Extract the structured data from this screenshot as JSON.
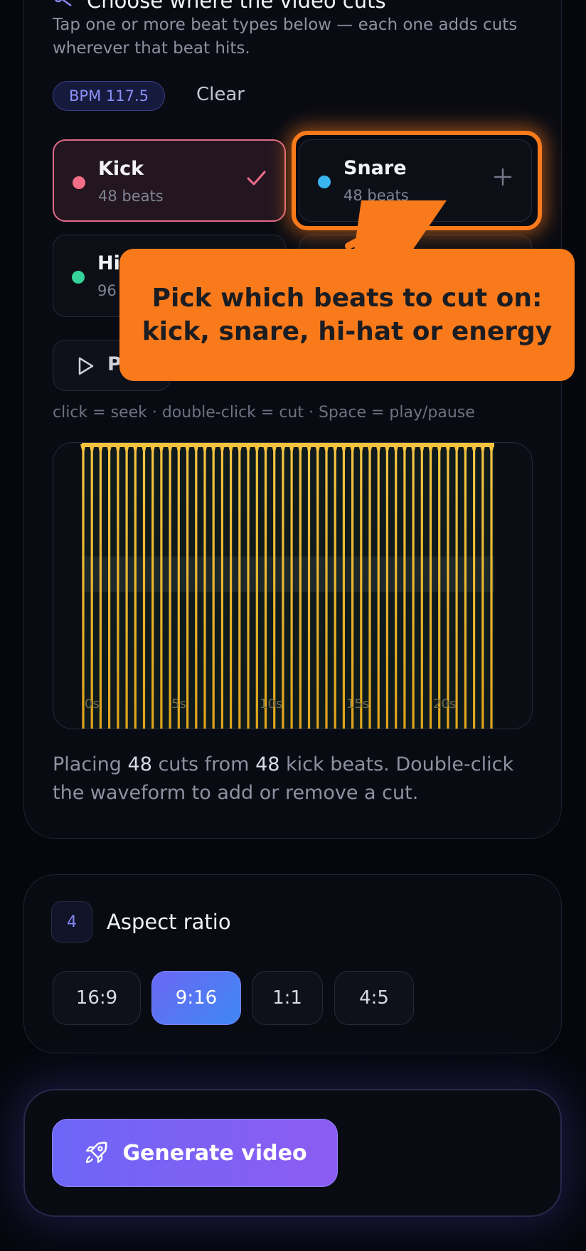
{
  "cuts": {
    "title": "Choose where the video cuts",
    "description": "Tap one or more beat types below — each one adds cuts wherever that beat hits.",
    "bpm": "BPM 117.5",
    "clear": "Clear",
    "beats": [
      {
        "name": "Kick",
        "count": "48 beats",
        "color": "#f26d85",
        "selected": true
      },
      {
        "name": "Snare",
        "count": "48 beats",
        "color": "#39b5f0",
        "selected": false
      },
      {
        "name": "Hi",
        "count": "96",
        "color": "#34d399",
        "selected": false
      }
    ],
    "play_label": "P",
    "hint": "click = seek · double-click = cut · Space = play/pause",
    "time_labels": [
      "0s",
      "5s",
      "10s",
      "15s",
      "20s"
    ],
    "summary": {
      "prefix": "Placing ",
      "cuts": "48",
      "middle": " cuts from ",
      "beats": "48",
      "suffix": " kick beats. Double-click the waveform to add or remove a cut."
    }
  },
  "aspect": {
    "step": "4",
    "title": "Aspect ratio",
    "options": [
      "16:9",
      "9:16",
      "1:1",
      "4:5"
    ],
    "selected": "9:16"
  },
  "generate": {
    "label": "Generate video",
    "icon": "rocket-icon"
  },
  "callout": {
    "text": "Pick which beats to cut on: kick, snare, hi-hat or energy",
    "color": "#f97a1a"
  }
}
